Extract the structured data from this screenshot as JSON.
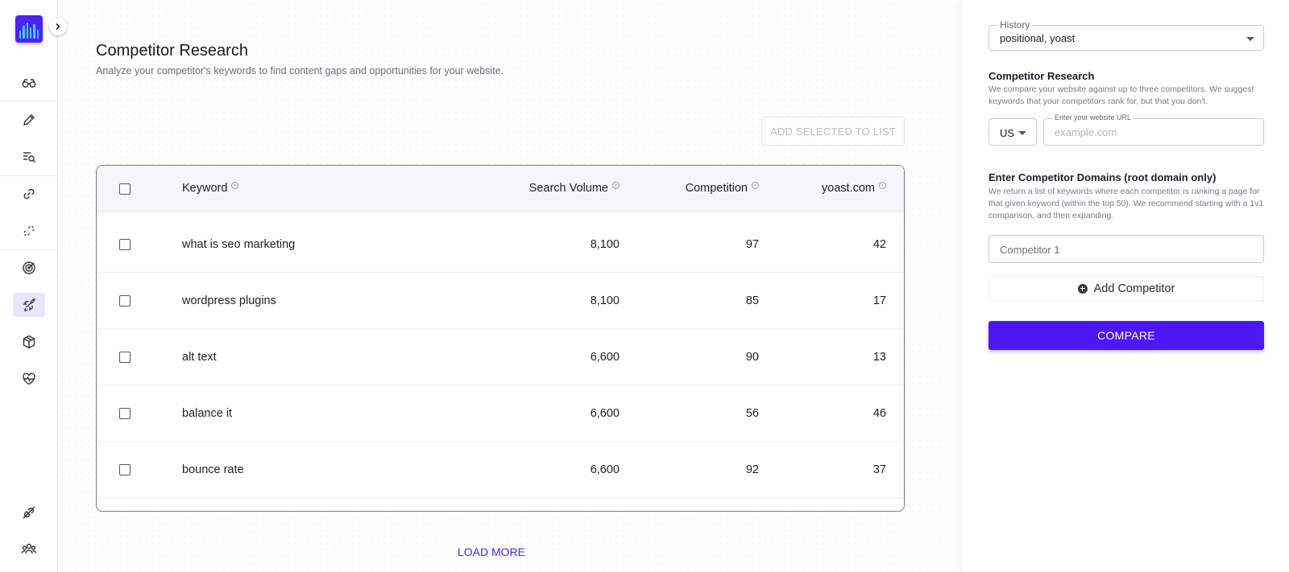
{
  "sidebar": {
    "brand_color": "#4b22f4",
    "nav_icons": [
      "binoculars-icon",
      "pencil-icon",
      "list-search-icon",
      "link-icon",
      "broken-link-icon",
      "target-icon",
      "rocket-icon",
      "package-icon",
      "heart-pulse-icon",
      "plug-off-icon",
      "team-icon"
    ],
    "active_item": "rocket-icon"
  },
  "main": {
    "title": "Competitor Research",
    "subtitle": "Analyze your competitor's keywords to find content gaps and opportunities for your website.",
    "add_selected_label": "ADD SELECTED TO LIST",
    "load_more_label": "LOAD MORE",
    "table": {
      "headers": {
        "keyword": "Keyword",
        "search_volume": "Search Volume",
        "competition": "Competition",
        "domain": "yoast.com"
      },
      "rows": [
        {
          "keyword": "what is seo marketing",
          "search_volume": "8,100",
          "competition": "97",
          "rank": "42"
        },
        {
          "keyword": "wordpress plugins",
          "search_volume": "8,100",
          "competition": "85",
          "rank": "17"
        },
        {
          "keyword": "alt text",
          "search_volume": "6,600",
          "competition": "90",
          "rank": "13"
        },
        {
          "keyword": "balance it",
          "search_volume": "6,600",
          "competition": "56",
          "rank": "46"
        },
        {
          "keyword": "bounce rate",
          "search_volume": "6,600",
          "competition": "92",
          "rank": "37"
        }
      ]
    }
  },
  "panel": {
    "history": {
      "legend": "History",
      "value": "positional, yoast"
    },
    "research": {
      "title": "Competitor Research",
      "description": "We compare your website against up to three competitors. We suggest keywords that your competitors rank for, but that you don't."
    },
    "country": "US",
    "url_field": {
      "legend": "Enter your website URL",
      "placeholder": "example.com"
    },
    "domains": {
      "title": "Enter Competitor Domains (root domain only)",
      "description": "We return a list of keywords where each competitor is ranking a page for that given keyword (within the top 50). We recommend starting with a 1v1 comparison, and then expanding."
    },
    "competitor_placeholder": "Competitor 1",
    "add_competitor_label": "Add Competitor",
    "compare_label": "COMPARE",
    "accent_color": "#4b17f5"
  }
}
